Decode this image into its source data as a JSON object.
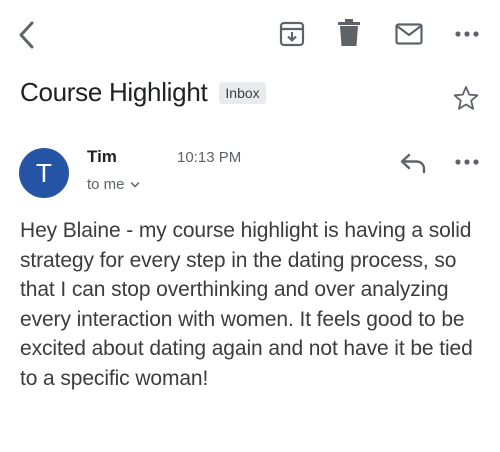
{
  "toolbar": {
    "icons": [
      "back-arrow",
      "archive",
      "delete",
      "mark-unread-mail",
      "more-vert"
    ]
  },
  "email": {
    "subject": "Course Highlight",
    "label": "Inbox",
    "sender": {
      "initial": "T",
      "name": "Tim",
      "time": "10:13 PM",
      "recipient_text": "to me",
      "avatar_color": "#2654a5"
    },
    "body": "Hey Blaine - my course highlight is having a solid strategy for every step in the dating process, so that I can stop overthinking and over analyzing every interaction with women. It feels good to be excited about dating again and not have it be tied to a specific woman!"
  }
}
